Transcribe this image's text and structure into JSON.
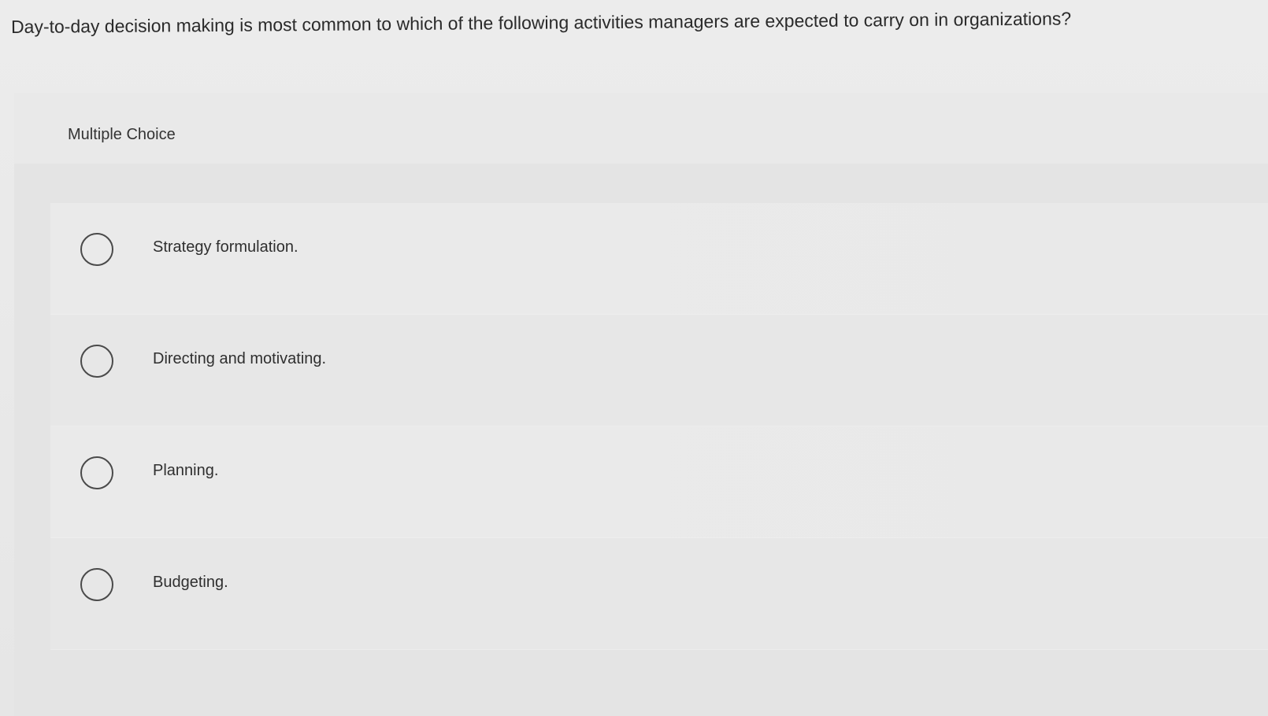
{
  "question": "Day-to-day decision making is most common to which of the following activities managers are expected to carry on in organizations?",
  "choice_type": "Multiple Choice",
  "options": [
    {
      "label": "Strategy formulation.",
      "icon": "radio-button-empty-icon"
    },
    {
      "label": "Directing and motivating.",
      "icon": "radio-button-empty-icon"
    },
    {
      "label": "Planning.",
      "icon": "radio-button-empty-icon"
    },
    {
      "label": "Budgeting.",
      "icon": "radio-button-empty-icon"
    }
  ],
  "colors": {
    "background": "#e9e9e9",
    "panel": "#e4e4e4",
    "text": "#2b2b2b",
    "radio_border": "#4a4a4a"
  }
}
